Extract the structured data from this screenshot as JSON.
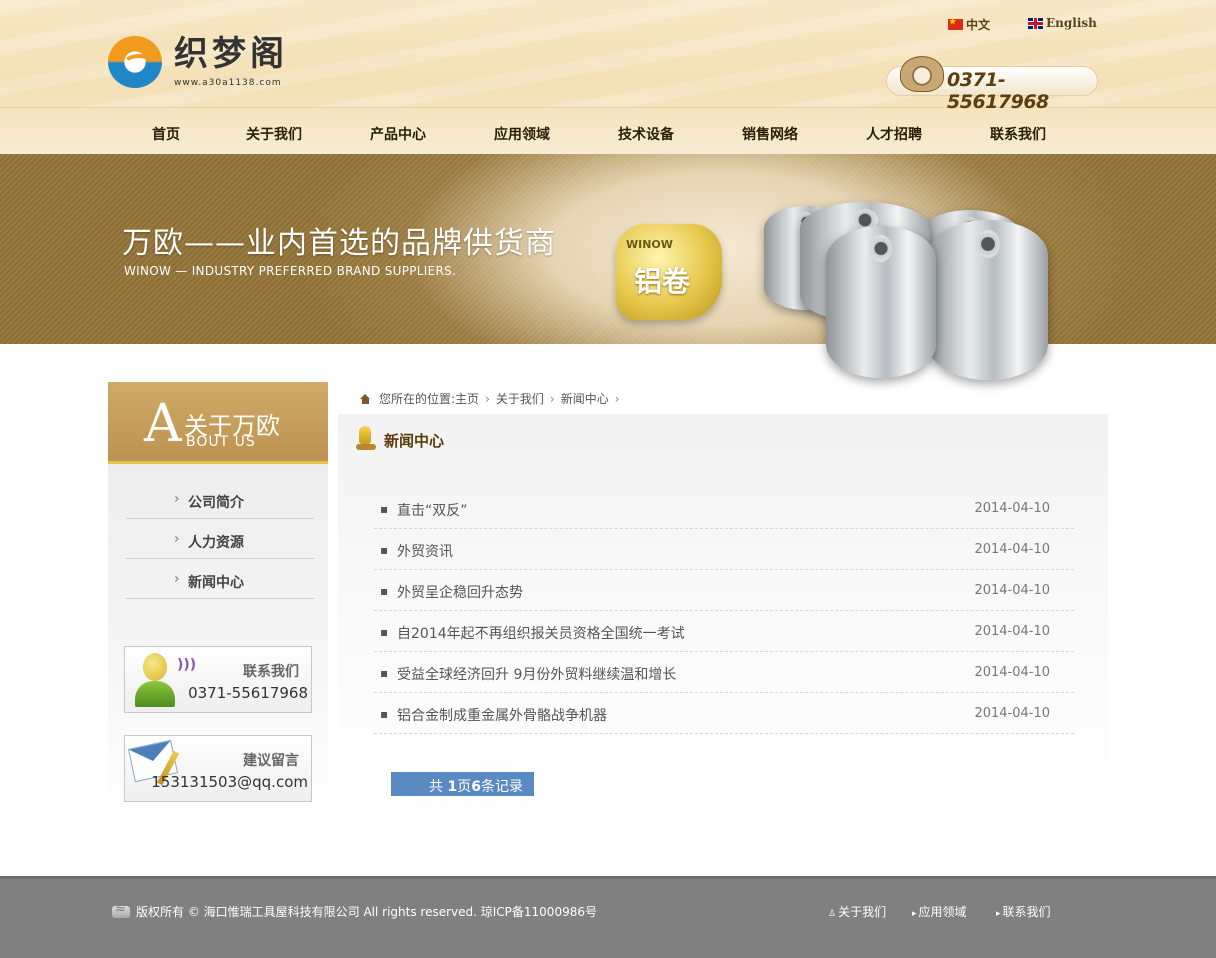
{
  "header": {
    "logo_name": "织梦阁",
    "logo_url": "www.a30a1138.com",
    "lang_cn": "中文",
    "lang_en": "English",
    "phone": "0371-55617968"
  },
  "nav": [
    "首页",
    "关于我们",
    "产品中心",
    "应用领域",
    "技术设备",
    "销售网络",
    "人才招聘",
    "联系我们"
  ],
  "banner": {
    "title": "万欧——业内首选的品牌供货商",
    "subtitle": "WINOW — INDUSTRY PREFERRED BRAND SUPPLIERS.",
    "badge_brand": "WINOW",
    "badge_text": "铝卷"
  },
  "sidebar": {
    "head_letter": "A",
    "head_cn": "关于万欧",
    "head_en": "BOUT US",
    "items": [
      "公司简介",
      "人力资源",
      "新闻中心"
    ],
    "contact_title": "联系我们",
    "contact_phone": "0371-55617968",
    "message_title": "建议留言",
    "message_email": "153131503@qq.com"
  },
  "breadcrumb": {
    "prefix": "您所在的位置:",
    "items": [
      "主页",
      "关于我们",
      "新闻中心"
    ]
  },
  "section_title": "新闻中心",
  "news": [
    {
      "title": "直击“双反”",
      "date": "2014-04-10"
    },
    {
      "title": "外贸资讯",
      "date": "2014-04-10"
    },
    {
      "title": "外贸呈企稳回升态势",
      "date": "2014-04-10"
    },
    {
      "title": "自2014年起不再组织报关员资格全国统一考试",
      "date": "2014-04-10"
    },
    {
      "title": "受益全球经济回升 9月份外贸料继续温和增长",
      "date": "2014-04-10"
    },
    {
      "title": "铝合金制成重金属外骨骼战争机器",
      "date": "2014-04-10"
    }
  ],
  "pager": {
    "total_label": "共",
    "pages": "1",
    "pages_unit": "页",
    "records": "6",
    "records_unit": "条记录"
  },
  "footer": {
    "copyright": "版权所有 © 海口惟瑞工具屋科技有限公司 All rights reserved. 琼ICP备11000986号",
    "links": [
      "关于我们",
      "应用领域",
      "联系我们"
    ]
  }
}
